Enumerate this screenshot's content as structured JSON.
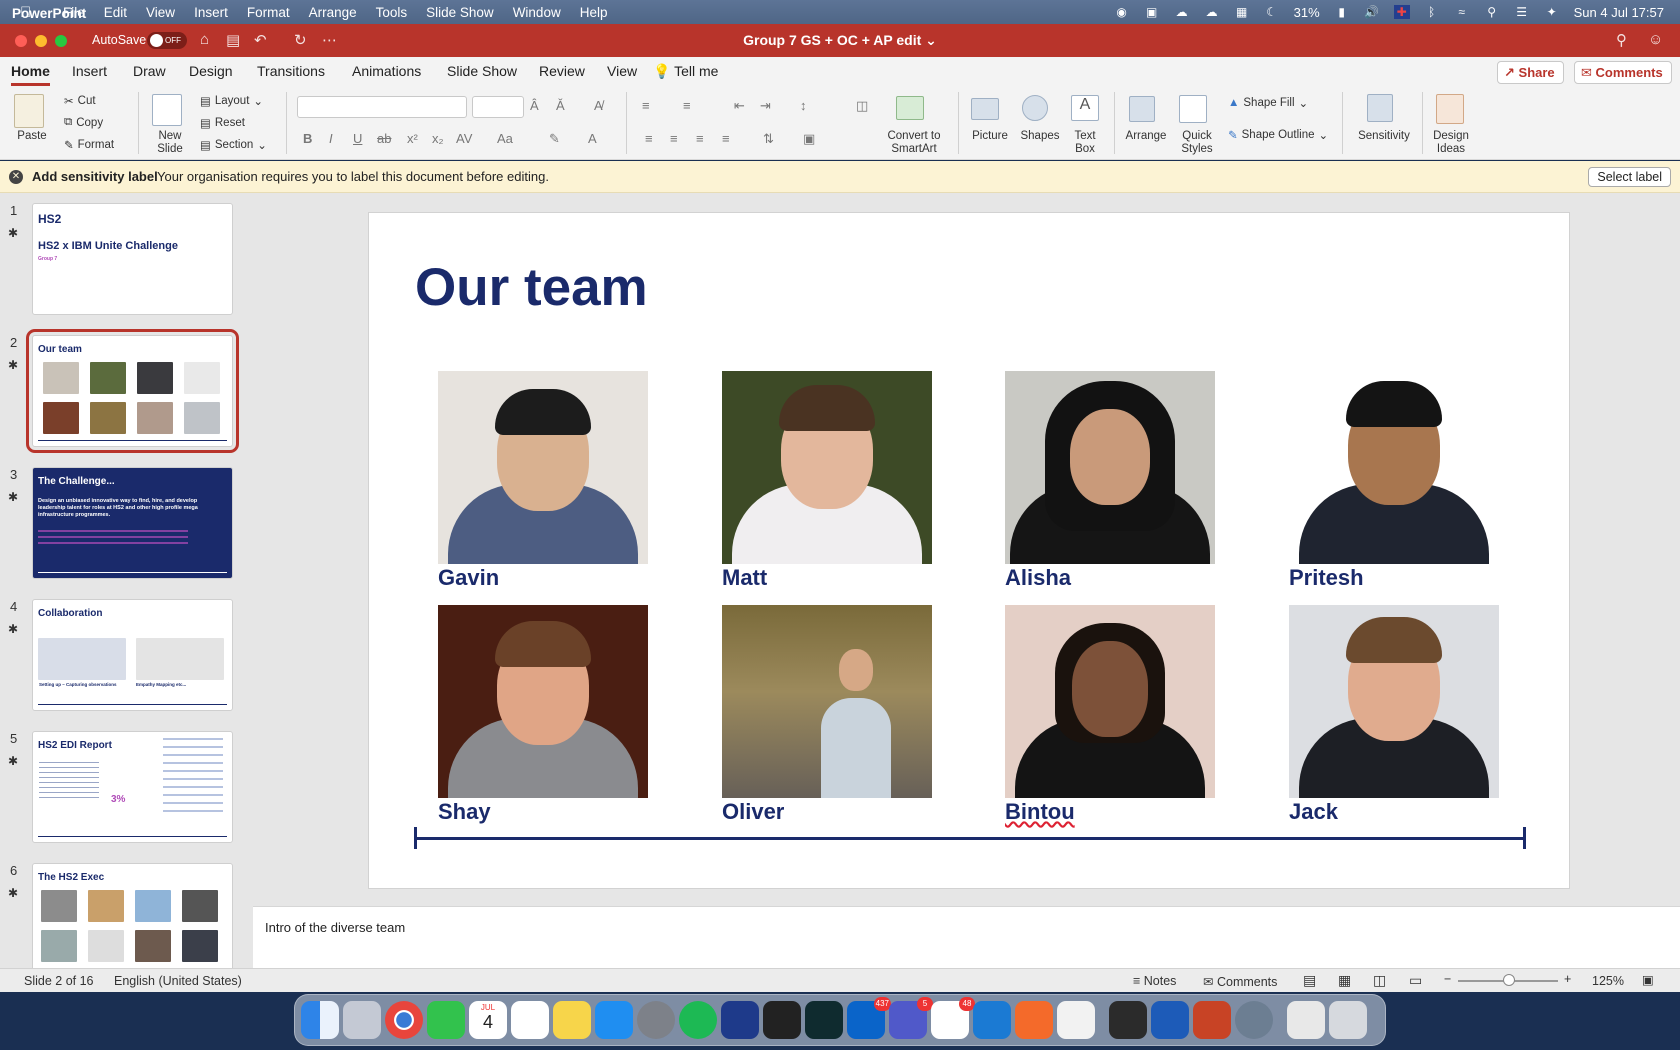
{
  "menubar": {
    "app_name": "PowerPoint",
    "menus": [
      "File",
      "Edit",
      "View",
      "Insert",
      "Format",
      "Arrange",
      "Tools",
      "Slide Show",
      "Window",
      "Help"
    ],
    "battery": "31%",
    "datetime": "Sun 4 Jul  17:57"
  },
  "titlebar": {
    "autosave_label": "AutoSave",
    "autosave_state": "OFF",
    "document_title": "Group 7 GS  + OC + AP edit"
  },
  "tabs": [
    "Home",
    "Insert",
    "Draw",
    "Design",
    "Transitions",
    "Animations",
    "Slide Show",
    "Review",
    "View"
  ],
  "tell_me": "Tell me",
  "share_label": "Share",
  "comments_label": "Comments",
  "ribbon": {
    "paste": "Paste",
    "cut": "Cut",
    "copy": "Copy",
    "format": "Format",
    "new_slide": [
      "New",
      "Slide"
    ],
    "layout": "Layout",
    "reset": "Reset",
    "section": "Section",
    "convert_smartart": [
      "Convert to",
      "SmartArt"
    ],
    "picture": "Picture",
    "shapes": "Shapes",
    "text_box": [
      "Text",
      "Box"
    ],
    "arrange": "Arrange",
    "quick_styles": [
      "Quick",
      "Styles"
    ],
    "shape_fill": "Shape Fill",
    "shape_outline": "Shape Outline",
    "sensitivity": "Sensitivity",
    "design_ideas": [
      "Design",
      "Ideas"
    ]
  },
  "infobar": {
    "title": "Add sensitivity label",
    "message": "Your organisation requires you to label this document before editing.",
    "button": "Select label"
  },
  "thumbnails": [
    {
      "num": "1",
      "title": "HS2",
      "subtitle": "HS2 x IBM Unite Challenge",
      "caption": "Group 7"
    },
    {
      "num": "2",
      "title": "Our team"
    },
    {
      "num": "3",
      "title": "The Challenge...",
      "body": "Design an unbiased innovative way to find, hire, and develop leadership talent for roles at HS2 and other high profile mega infrastructure programmes."
    },
    {
      "num": "4",
      "title": "Collaboration",
      "captions": [
        "Setting up – Capturing observations",
        "Empathy Mapping etc..."
      ]
    },
    {
      "num": "5",
      "title": "HS2 EDI Report",
      "stat": "3%"
    },
    {
      "num": "6",
      "title": "The HS2 Exec"
    }
  ],
  "slide": {
    "title": "Our team",
    "members": [
      "Gavin",
      "Matt",
      "Alisha",
      "Pritesh",
      "Shay",
      "Oliver",
      "Bintou",
      "Jack"
    ]
  },
  "notes": "Intro of the diverse team",
  "status": {
    "slide_position": "Slide 2 of 16",
    "language": "English (United States)",
    "notes_label": "Notes",
    "comments_label": "Comments",
    "zoom": "125%"
  },
  "dock": {
    "calendar_month": "JUL",
    "calendar_day": "4",
    "outlook_badge": "437",
    "teams_badge": "5",
    "slack_badge": "48"
  },
  "colors": {
    "accent": "#b8342b",
    "slide_navy": "#1a2a6b",
    "infobar": "#fcf3d4"
  }
}
